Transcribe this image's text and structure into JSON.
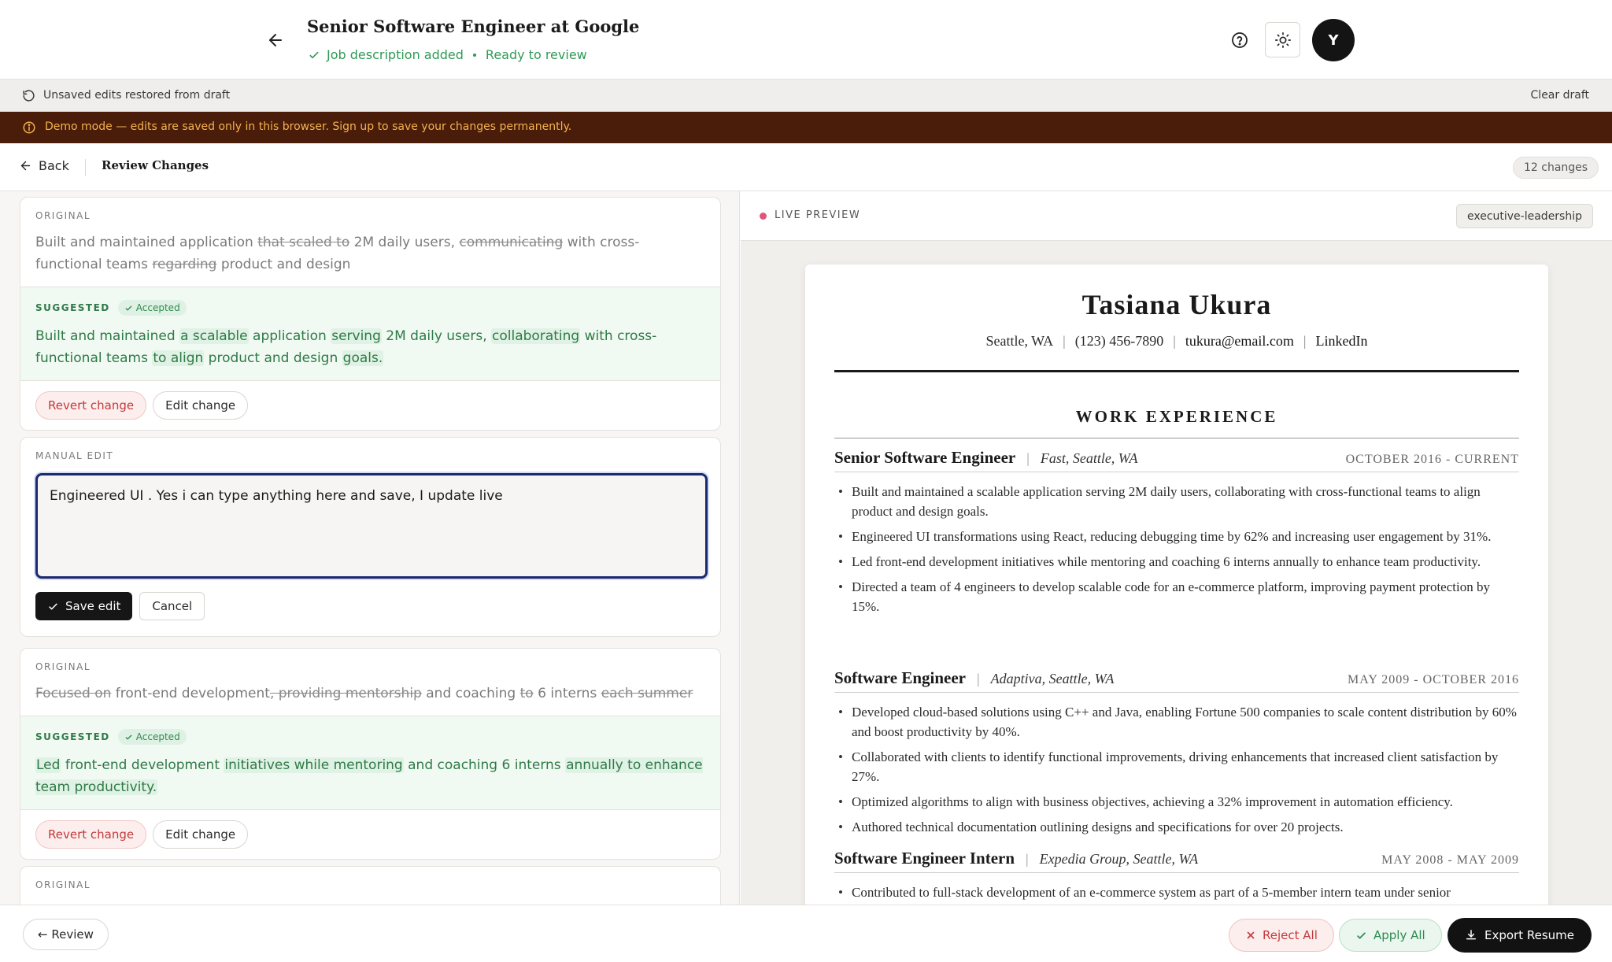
{
  "header": {
    "title": "Senior Software Engineer at Google",
    "status_jd": "Job description added",
    "status_ready": "Ready to review",
    "avatar_initial": "Y"
  },
  "draft_bar": {
    "text": "Unsaved edits restored from draft",
    "clear_label": "Clear draft"
  },
  "demo_bar": {
    "text": "Demo mode — edits are saved only in this browser. Sign up to save your changes permanently."
  },
  "review_bar": {
    "back_label": "Back",
    "title": "Review Changes",
    "changes_count": "12 changes"
  },
  "labels": {
    "original": "ORIGINAL",
    "suggested": "SUGGESTED",
    "accepted": "Accepted",
    "manual_edit": "MANUAL EDIT",
    "revert": "Revert change",
    "edit": "Edit change",
    "save_edit": "Save edit",
    "cancel": "Cancel"
  },
  "cards": {
    "c1": {
      "original_parts": [
        "Built and maintained application ",
        "that scaled to",
        " 2M daily users, ",
        "communicating",
        " with cross-functional teams ",
        "regarding",
        " product and design"
      ],
      "suggested_parts": [
        "Built and maintained ",
        "a scalable",
        " application ",
        "serving",
        " 2M daily users, ",
        "collaborating",
        " with cross-functional teams ",
        "to align",
        " product and design ",
        "goals."
      ]
    },
    "manual": {
      "value": "Engineered UI . Yes i can type anything here and save, I update live"
    },
    "c3": {
      "original_parts": [
        "Focused on",
        " front-end development",
        ", providing mentorship",
        " and coaching ",
        "to",
        " 6 interns ",
        "each summer"
      ],
      "suggested_parts": [
        "Led",
        " front-end development ",
        "initiatives while mentoring",
        " and coaching 6 interns ",
        "annually to enhance team productivity."
      ]
    }
  },
  "preview": {
    "live_label": "LIVE PREVIEW",
    "template": "executive-leadership"
  },
  "resume": {
    "name": "Tasiana Ukura",
    "location": "Seattle, WA",
    "phone": "(123) 456-7890",
    "email": "tukura@email.com",
    "linkedin": "LinkedIn",
    "section": "WORK EXPERIENCE",
    "jobs": [
      {
        "title": "Senior Software Engineer",
        "company": "Fast, Seattle, WA",
        "dates": "OCTOBER 2016 - CURRENT",
        "bullets": [
          "Built and maintained a scalable application serving 2M daily users, collaborating with cross-functional teams to align product and design goals.",
          "Engineered UI transformations using React, reducing debugging time by 62% and increasing user engagement by 31%.",
          "Led front-end development initiatives while mentoring and coaching 6 interns annually to enhance team productivity.",
          "Directed a team of 4 engineers to develop scalable code for an e-commerce platform, improving payment protection by 15%."
        ]
      },
      {
        "title": "Software Engineer",
        "company": "Adaptiva, Seattle, WA",
        "dates": "MAY 2009 - OCTOBER 2016",
        "bullets": [
          "Developed cloud-based solutions using C++ and Java, enabling Fortune 500 companies to scale content distribution by 60% and boost productivity by 40%.",
          "Collaborated with clients to identify functional improvements, driving enhancements that increased client satisfaction by 27%.",
          "Optimized algorithms to align with business objectives, achieving a 32% improvement in automation efficiency.",
          "Authored technical documentation outlining designs and specifications for over 20 projects."
        ]
      },
      {
        "title": "Software Engineer Intern",
        "company": "Expedia Group, Seattle, WA",
        "dates": "MAY 2008 - MAY 2009",
        "bullets": [
          "Contributed to full-stack development of an e-commerce system as part of a 5-member intern team under senior"
        ]
      }
    ]
  },
  "footer": {
    "review_label": "← Review",
    "reject_label": "Reject All",
    "apply_label": "Apply All",
    "export_label": "Export Resume"
  },
  "colors": {
    "accent_green": "#2f9a55",
    "demo_bg": "#4a1d0a",
    "demo_text": "#f4b24c",
    "reject_red": "#c23a3a",
    "focus_blue": "#1a2a6e",
    "live_dot": "#e0567a"
  }
}
